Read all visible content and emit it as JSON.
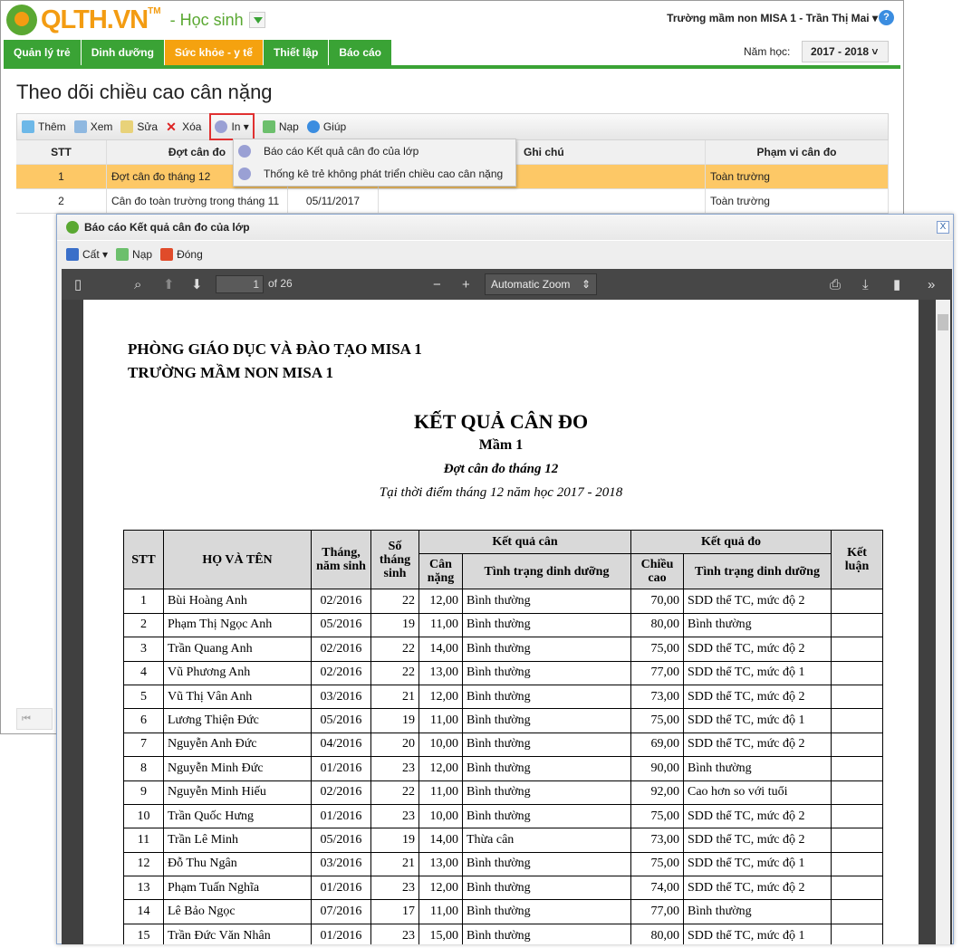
{
  "app": {
    "logo": "QLTH.VN",
    "tm": "TM",
    "module": "- Học sinh",
    "user": "Trường mầm non MISA 1 - Trần Thị Mai",
    "help": "?"
  },
  "nav": [
    "Quản lý trẻ",
    "Dinh dưỡng",
    "Sức khỏe - y tế",
    "Thiết lập",
    "Báo cáo"
  ],
  "year": {
    "label": "Năm học:",
    "value": "2017 - 2018"
  },
  "page_title": "Theo dõi chiều cao cân nặng",
  "toolbar": {
    "add": "Thêm",
    "view": "Xem",
    "edit": "Sửa",
    "delete": "Xóa",
    "print": "In",
    "reload": "Nạp",
    "help": "Giúp"
  },
  "grid": {
    "headers": [
      "STT",
      "Đợt cân đo",
      "",
      "Ghi chú",
      "Phạm vi cân đo"
    ],
    "rows": [
      [
        "1",
        "Đợt cân đo tháng 12",
        "",
        "",
        "Toàn trường"
      ],
      [
        "2",
        "Cân đo toàn trường trong tháng 11",
        "05/11/2017",
        "",
        "Toàn trường"
      ]
    ]
  },
  "print_menu": [
    "Báo cáo Kết quả cân đo của lớp",
    "Thống kê trẻ không phát triển chiều cao cân nặng"
  ],
  "dialog": {
    "title": "Báo cáo Kết quả cân đo của lớp",
    "close": "X",
    "save": "Cất",
    "reload": "Nạp",
    "close_btn": "Đóng"
  },
  "pdf": {
    "page": "1",
    "of": "of 26",
    "zoom": "Automatic Zoom"
  },
  "report": {
    "org1": "PHÒNG GIÁO DỤC VÀ ĐÀO TẠO MISA 1",
    "org2": "TRƯỜNG MẦM NON MISA 1",
    "title": "KẾT QUẢ CÂN ĐO",
    "class": "Mầm 1",
    "period": "Đợt cân đo tháng 12",
    "time": "Tại thời điểm tháng 12 năm học 2017 - 2018",
    "headers": {
      "stt": "STT",
      "name": "HỌ VÀ TÊN",
      "dob": "Tháng, năm sinh",
      "months": "Số tháng sinh",
      "weigh": "Kết quả cân",
      "measure": "Kết quả đo",
      "weight": "Cân nặng",
      "wstatus": "Tình trạng dinh dưỡng",
      "height": "Chiều cao",
      "hstatus": "Tình trạng dinh dưỡng",
      "conclusion": "Kết luận"
    },
    "rows": [
      [
        "1",
        "Bùi Hoàng Anh",
        "02/2016",
        "22",
        "12,00",
        "Bình thường",
        "70,00",
        "SDD thể TC, mức độ 2",
        ""
      ],
      [
        "2",
        "Phạm Thị Ngọc Anh",
        "05/2016",
        "19",
        "11,00",
        "Bình thường",
        "80,00",
        "Bình thường",
        ""
      ],
      [
        "3",
        "Trần Quang Anh",
        "02/2016",
        "22",
        "14,00",
        "Bình thường",
        "75,00",
        "SDD thể TC, mức độ 2",
        ""
      ],
      [
        "4",
        "Vũ Phương Anh",
        "02/2016",
        "22",
        "13,00",
        "Bình thường",
        "77,00",
        "SDD thể TC, mức độ 1",
        ""
      ],
      [
        "5",
        "Vũ Thị Vân Anh",
        "03/2016",
        "21",
        "12,00",
        "Bình thường",
        "73,00",
        "SDD thể TC, mức độ 2",
        ""
      ],
      [
        "6",
        "Lương Thiện Đức",
        "05/2016",
        "19",
        "11,00",
        "Bình thường",
        "75,00",
        "SDD thể TC, mức độ 1",
        ""
      ],
      [
        "7",
        "Nguyễn Anh Đức",
        "04/2016",
        "20",
        "10,00",
        "Bình thường",
        "69,00",
        "SDD thể TC, mức độ 2",
        ""
      ],
      [
        "8",
        "Nguyễn Minh Đức",
        "01/2016",
        "23",
        "12,00",
        "Bình thường",
        "90,00",
        "Bình thường",
        ""
      ],
      [
        "9",
        "Nguyễn Minh Hiếu",
        "02/2016",
        "22",
        "11,00",
        "Bình thường",
        "92,00",
        "Cao hơn so với tuổi",
        ""
      ],
      [
        "10",
        "Trần Quốc Hưng",
        "01/2016",
        "23",
        "10,00",
        "Bình thường",
        "75,00",
        "SDD thể TC, mức độ 2",
        ""
      ],
      [
        "11",
        "Trần Lê Minh",
        "05/2016",
        "19",
        "14,00",
        "Thừa cân",
        "73,00",
        "SDD thể TC, mức độ 2",
        ""
      ],
      [
        "12",
        "Đỗ Thu Ngân",
        "03/2016",
        "21",
        "13,00",
        "Bình thường",
        "75,00",
        "SDD thể TC, mức độ 1",
        ""
      ],
      [
        "13",
        "Phạm Tuấn Nghĩa",
        "01/2016",
        "23",
        "12,00",
        "Bình thường",
        "74,00",
        "SDD thể TC, mức độ 2",
        ""
      ],
      [
        "14",
        "Lê Bảo Ngọc",
        "07/2016",
        "17",
        "11,00",
        "Bình thường",
        "77,00",
        "Bình thường",
        ""
      ],
      [
        "15",
        "Trần Đức Văn Nhân",
        "01/2016",
        "23",
        "15,00",
        "Bình thường",
        "80,00",
        "SDD thể TC, mức độ 1",
        ""
      ]
    ]
  }
}
